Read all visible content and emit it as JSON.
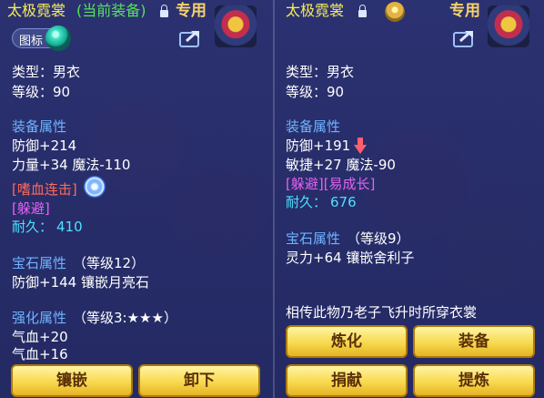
{
  "left_panel": {
    "name": "太极霓裳",
    "equip_status": "(当前装备)",
    "exclusive": "专用",
    "icon_toggle_label": "图标",
    "type_line": "类型：男衣",
    "level_line": "等级：90",
    "equip_attr_header": "装备属性",
    "attr_lines": [
      "防御+214",
      "力量+34 魔法-110"
    ],
    "skill_tag": "[嗜血连击]",
    "special_tag": "[躲避]",
    "durability_label": "耐久：",
    "durability_value": "410",
    "gem_header": "宝石属性",
    "gem_level": "（等级12）",
    "gem_line": "防御+144 镶嵌月亮石",
    "enhance_header": "强化属性",
    "enhance_level": "（等级3:★★★）",
    "enhance_lines": [
      "气血+20",
      "气血+16"
    ],
    "buttons": [
      "镶嵌",
      "卸下"
    ]
  },
  "right_panel": {
    "name": "太极霓裳",
    "exclusive": "专用",
    "type_line": "类型：男衣",
    "level_line": "等级：90",
    "equip_attr_header": "装备属性",
    "attr_lines": [
      "防御+191",
      "敏捷+27 魔法-90"
    ],
    "special_tag": "[躲避][易成长]",
    "durability_label": "耐久：",
    "durability_value": "676",
    "gem_header": "宝石属性",
    "gem_level": "（等级9）",
    "gem_line": "灵力+64 镶嵌舍利子",
    "description": "相传此物乃老子飞升时所穿衣裳",
    "buttons": [
      "炼化",
      "装备",
      "捐献",
      "提炼"
    ]
  },
  "colors": {
    "title": "#f6ec5a",
    "equipped": "#55e35a",
    "section": "#6fb4ff",
    "skill": "#ff6a5a",
    "special": "#e462f2",
    "durability": "#4ee0ff",
    "button": "#f7d94f"
  },
  "icons": [
    "lock-icon",
    "share-icon",
    "avatar-icon",
    "gem-orb-icon",
    "swirl-icon",
    "seal-icon",
    "down-arrow-icon"
  ]
}
